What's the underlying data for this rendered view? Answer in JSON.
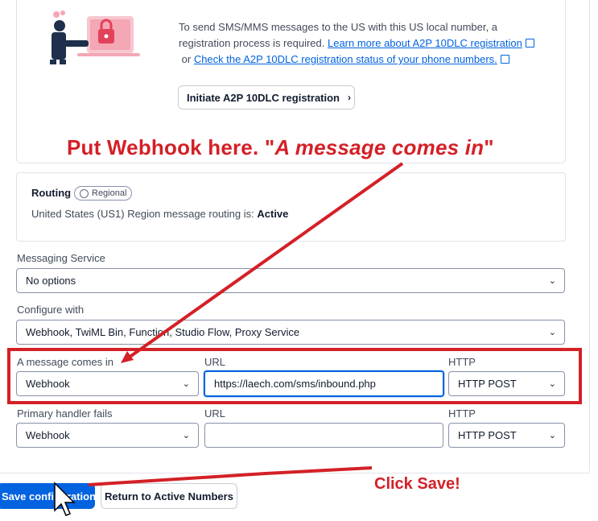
{
  "registration": {
    "text_before": "To send SMS/MMS messages to the US with this US local number, a registration process is required.",
    "link_learn": "Learn more about A2P 10DLC registration",
    "text_or": "or",
    "link_check": "Check the A2P 10DLC registration status of your phone numbers.",
    "button_label": "Initiate A2P 10DLC registration"
  },
  "annotations": {
    "top_prefix": "Put Webhook here. \"",
    "top_italic": "A message comes in",
    "top_suffix": "\"",
    "click_save": "Click Save!",
    "color": "#d42027"
  },
  "routing": {
    "title": "Routing",
    "badge": "Regional",
    "text_prefix": "United States (US1) Region message routing is:",
    "status": "Active"
  },
  "messaging_service": {
    "label": "Messaging Service",
    "value": "No options"
  },
  "configure_with": {
    "label": "Configure with",
    "value": "Webhook, TwiML Bin, Function, Studio Flow, Proxy Service"
  },
  "message_comes_in": {
    "label": "A message comes in",
    "type_value": "Webhook",
    "url_label": "URL",
    "url_value": "https://laech.com/sms/inbound.php",
    "http_label": "HTTP",
    "http_value": "HTTP POST"
  },
  "primary_handler_fails": {
    "label": "Primary handler fails",
    "type_value": "Webhook",
    "url_label": "URL",
    "url_value": "",
    "http_label": "HTTP",
    "http_value": "HTTP POST"
  },
  "actions": {
    "save_label": "Save configuration",
    "return_label": "Return to Active Numbers"
  },
  "colors": {
    "primary": "#0263e0",
    "annotation_red": "#d42027"
  }
}
